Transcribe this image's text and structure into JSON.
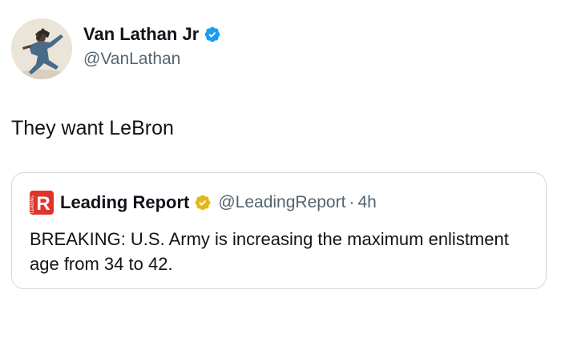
{
  "colors": {
    "verified_blue": "#1d9bf0",
    "verified_gold": "#e2b719",
    "brand_red": "#e0342b",
    "secondary_text": "#536471",
    "border": "#cfd9de"
  },
  "author": {
    "display_name": "Van Lathan Jr",
    "handle": "@VanLathan",
    "verified_icon": "verified-badge-blue"
  },
  "tweet": {
    "text": "They want LeBron"
  },
  "quoted_tweet": {
    "logo_icon": "leading-report-logo",
    "logo_letter": "R",
    "logo_small_text": "LEADING",
    "display_name": "Leading Report",
    "verified_icon": "verified-badge-gold",
    "handle": "@LeadingReport",
    "separator": "·",
    "time": "4h",
    "text": "BREAKING: U.S. Army is increasing the maximum enlistment age from 34 to 42."
  }
}
